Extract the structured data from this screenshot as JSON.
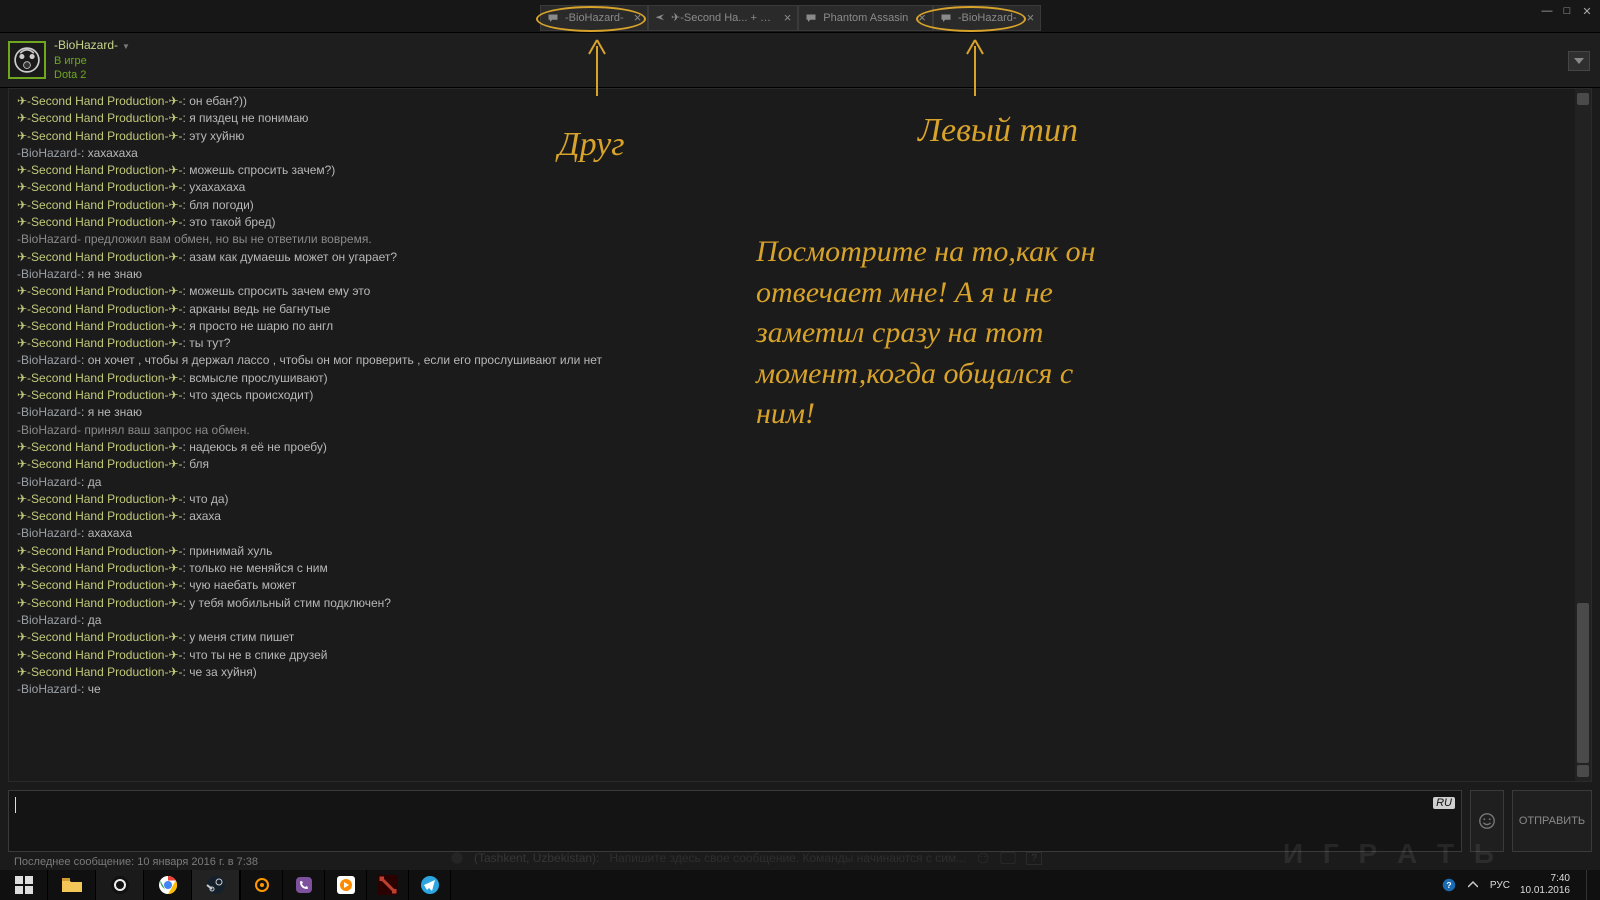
{
  "tabs": [
    {
      "label": "-BioHazard-",
      "icon": "chat"
    },
    {
      "label": "✈-Second Ha... + Phant...",
      "icon": "plane"
    },
    {
      "label": "Phantom Assasin",
      "icon": "chat"
    },
    {
      "label": "-BioHazard-",
      "icon": "chat"
    }
  ],
  "contact": {
    "name": "-BioHazard-",
    "status": "В игре",
    "game": "Dota 2"
  },
  "messages": [
    {
      "type": "shp",
      "text": "он ебан?))"
    },
    {
      "type": "shp",
      "text": "я пиздец не понимаю"
    },
    {
      "type": "shp",
      "text": "эту хуйню"
    },
    {
      "type": "bh",
      "text": "хахахаха"
    },
    {
      "type": "shp",
      "text": "можешь спросить зачем?)"
    },
    {
      "type": "shp",
      "text": "ухахахаха"
    },
    {
      "type": "shp",
      "text": "бля погоди)"
    },
    {
      "type": "shp",
      "text": "это такой бред)"
    },
    {
      "type": "sys",
      "text": "-BioHazard- предложил вам обмен, но вы не ответили вовремя."
    },
    {
      "type": "shp",
      "text": "азам как думаешь может он угарает?"
    },
    {
      "type": "bh",
      "text": "я не знаю"
    },
    {
      "type": "shp",
      "text": "можешь спросить зачем ему это"
    },
    {
      "type": "shp",
      "text": "арканы ведь не багнутые"
    },
    {
      "type": "shp",
      "text": "я просто не шарю по англ"
    },
    {
      "type": "shp",
      "text": "ты тут?"
    },
    {
      "type": "bh",
      "text": "он хочет , чтобы я держал лассо , чтобы он мог проверить , если его прослушивают или нет"
    },
    {
      "type": "shp",
      "text": "всмысле прослушивают)"
    },
    {
      "type": "shp",
      "text": "что здесь происходит)"
    },
    {
      "type": "bh",
      "text": "я не знаю"
    },
    {
      "type": "sys",
      "text": "-BioHazard- принял ваш запрос на обмен."
    },
    {
      "type": "shp",
      "text": "надеюсь я её не проебу)"
    },
    {
      "type": "shp",
      "text": "бля"
    },
    {
      "type": "bh",
      "text": "да"
    },
    {
      "type": "shp",
      "text": "что да)"
    },
    {
      "type": "shp",
      "text": "ахаха"
    },
    {
      "type": "bh",
      "text": "ахахаха"
    },
    {
      "type": "shp",
      "text": "принимай хуль"
    },
    {
      "type": "shp",
      "text": "только не меняйся  с ним"
    },
    {
      "type": "shp",
      "text": "чую наебать может"
    },
    {
      "type": "shp",
      "text": "у тебя мобильный стим подключен?"
    },
    {
      "type": "bh",
      "text": "да"
    },
    {
      "type": "shp",
      "text": "у меня стим пишет"
    },
    {
      "type": "shp",
      "text": "что ты не в спике друзей"
    },
    {
      "type": "shp",
      "text": "че за хуйня)"
    },
    {
      "type": "bh",
      "text": "че"
    }
  ],
  "author_shp": "✈-Second Hand Production-✈-",
  "author_bh": "-BioHazard-",
  "input": {
    "lang_indicator": "RU",
    "send_label": "ОТПРАВИТЬ"
  },
  "last_message": "Последнее сообщение: 10 января 2016 г. в 7:38",
  "annotations": {
    "friend": "Друг",
    "stranger": "Левый тип",
    "body": "Посмотрите на то,как он отвечает мне! А я и не заметил сразу на тот момент,когда общался с ним!"
  },
  "ghost": {
    "loc": "(Tashkent, Uzbekistan):",
    "placeholder": "Напишите здесь свое сообщение. Команды начинаются с сим...",
    "play": "И Г Р А Т Ь"
  },
  "taskbar": {
    "lang": "РУС",
    "time": "7:40",
    "date": "10.01.2016"
  }
}
